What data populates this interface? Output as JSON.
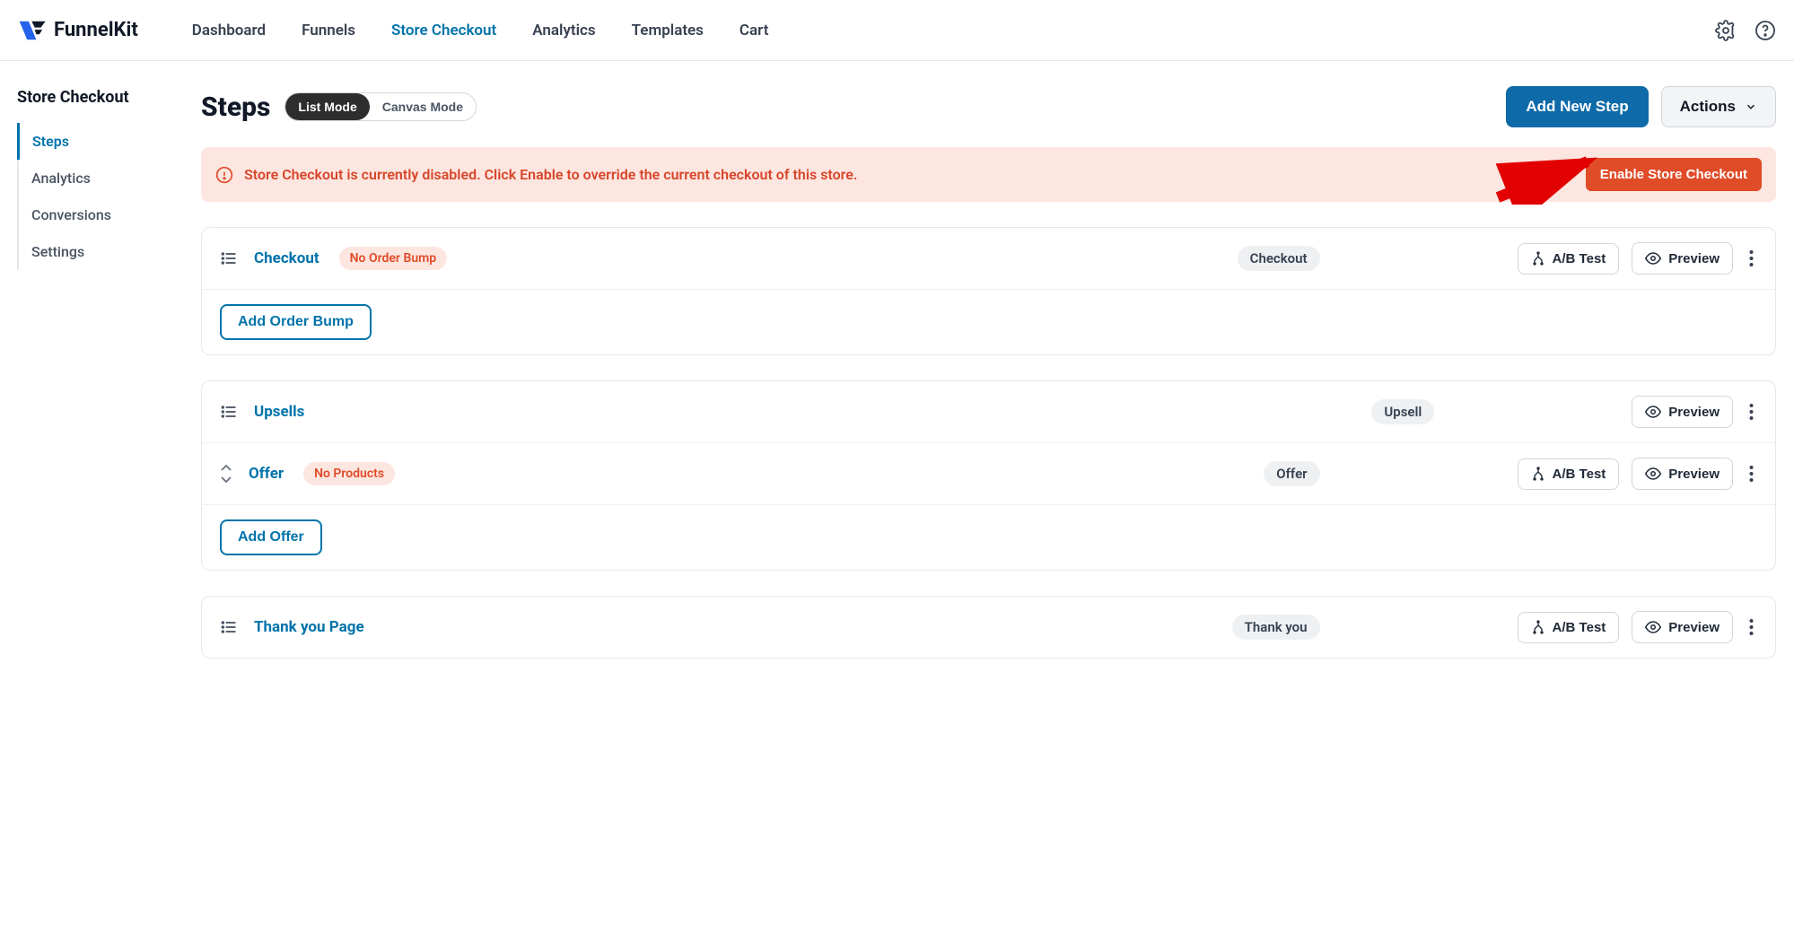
{
  "brand": "FunnelKit",
  "nav": {
    "items": [
      "Dashboard",
      "Funnels",
      "Store Checkout",
      "Analytics",
      "Templates",
      "Cart"
    ],
    "active_index": 2
  },
  "sidebar": {
    "title": "Store Checkout",
    "items": [
      "Steps",
      "Analytics",
      "Conversions",
      "Settings"
    ],
    "active_index": 0
  },
  "page": {
    "title": "Steps",
    "modes": {
      "list": "List Mode",
      "canvas": "Canvas Mode",
      "active": "list"
    },
    "add_step_label": "Add New Step",
    "actions_label": "Actions"
  },
  "alert": {
    "text": "Store Checkout is currently disabled. Click Enable to override the current checkout of this store.",
    "button_label": "Enable Store Checkout"
  },
  "buttons": {
    "ab_test": "A/B Test",
    "preview": "Preview",
    "add_order_bump": "Add Order Bump",
    "add_offer": "Add Offer"
  },
  "steps": [
    {
      "name": "Checkout",
      "warn": "No Order Bump",
      "type": "Checkout",
      "has_ab": true,
      "footer_action": "add_order_bump",
      "substeps": []
    },
    {
      "name": "Upsells",
      "warn": null,
      "type": "Upsell",
      "has_ab": false,
      "footer_action": "add_offer",
      "substeps": [
        {
          "name": "Offer",
          "warn": "No Products",
          "type": "Offer",
          "has_ab": true
        }
      ]
    },
    {
      "name": "Thank you Page",
      "warn": null,
      "type": "Thank you",
      "has_ab": true,
      "footer_action": null,
      "substeps": []
    }
  ]
}
